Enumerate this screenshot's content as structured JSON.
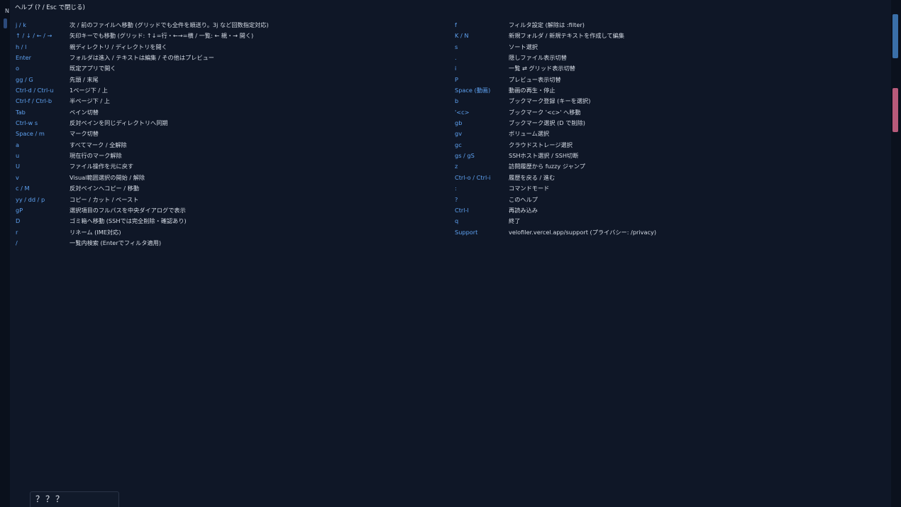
{
  "window": {
    "pane_letter": "N",
    "help_title": "ヘルプ (? / Esc で閉じる)"
  },
  "help": {
    "left": [
      {
        "key": "j / k",
        "desc": "次 / 前のファイルへ移動 (グリッドでも全件を順送り。3j など回数指定対応)"
      },
      {
        "key": "↑ / ↓ / ← / →",
        "desc": "矢印キーでも移動 (グリッド: ↑↓=行・←→=横 / 一覧: ← 親・→ 開く)"
      },
      {
        "key": "h / l",
        "desc": "親ディレクトリ / ディレクトリを開く"
      },
      {
        "key": "Enter",
        "desc": "フォルダは進入 / テキストは編集 / その他はプレビュー"
      },
      {
        "key": "o",
        "desc": "既定アプリで開く"
      },
      {
        "key": "gg / G",
        "desc": "先頭 / 末尾"
      },
      {
        "key": "Ctrl-d / Ctrl-u",
        "desc": "1ページ下 / 上"
      },
      {
        "key": "Ctrl-f / Ctrl-b",
        "desc": "半ページ下 / 上"
      },
      {
        "key": "Tab",
        "desc": "ペイン切替"
      },
      {
        "key": "Ctrl-w s",
        "desc": "反対ペインを同じディレクトリへ同期"
      },
      {
        "key": "Space / m",
        "desc": "マーク切替"
      },
      {
        "key": "a",
        "desc": "すべてマーク / 全解除"
      },
      {
        "key": "u",
        "desc": "現在行のマーク解除"
      },
      {
        "key": "U",
        "desc": "ファイル操作を元に戻す"
      },
      {
        "key": "v",
        "desc": "Visual範囲選択の開始 / 解除"
      },
      {
        "key": "c / M",
        "desc": "反対ペインへコピー / 移動"
      },
      {
        "key": "yy / dd / p",
        "desc": "コピー / カット / ペースト"
      },
      {
        "key": "gP",
        "desc": "選択項目のフルパスを中央ダイアログで表示"
      },
      {
        "key": "D",
        "desc": "ゴミ箱へ移動 (SSHでは完全削除・確認あり)"
      },
      {
        "key": "r",
        "desc": "リネーム (IME対応)"
      },
      {
        "key": "/",
        "desc": "一覧内検索 (Enterでフィルタ適用)"
      }
    ],
    "right": [
      {
        "key": "f",
        "desc": "フィルタ設定 (解除は :filter)"
      },
      {
        "key": "K / N",
        "desc": "新規フォルダ / 新規テキストを作成して編集"
      },
      {
        "key": "s",
        "desc": "ソート選択"
      },
      {
        "key": ".",
        "desc": "隠しファイル表示切替"
      },
      {
        "key": "i",
        "desc": "一覧 ⇄ グリッド表示切替"
      },
      {
        "key": "P",
        "desc": "プレビュー表示切替"
      },
      {
        "key": "Space (動画)",
        "desc": "動画の再生・停止"
      },
      {
        "key": "b",
        "desc": "ブックマーク登録 (キーを選択)"
      },
      {
        "key": "'<c>",
        "desc": "ブックマーク '<c>' へ移動"
      },
      {
        "key": "gb",
        "desc": "ブックマーク選択 (D で削除)"
      },
      {
        "key": "gv",
        "desc": "ボリューム選択"
      },
      {
        "key": "gc",
        "desc": "クラウドストレージ選択"
      },
      {
        "key": "gs / gS",
        "desc": "SSHホスト選択 / SSH切断"
      },
      {
        "key": "z",
        "desc": "訪問履歴から fuzzy ジャンプ"
      },
      {
        "key": "Ctrl-o / Ctrl-i",
        "desc": "履歴を戻る / 進む"
      },
      {
        "key": ":",
        "desc": "コマンドモード"
      },
      {
        "key": "?",
        "desc": "このヘルプ"
      },
      {
        "key": "Ctrl-l",
        "desc": "再読み込み"
      },
      {
        "key": "q",
        "desc": "終了"
      },
      {
        "key": "Support",
        "desc": "velofiler.vercel.app/support (プライバシー: /privacy)"
      }
    ]
  },
  "status": {
    "ime_text": "？？？"
  },
  "colors": {
    "key": "#5ea1f0",
    "text": "#d6dce6",
    "panel_bg": "#0f1727",
    "scroll_blue": "#3a6fa8",
    "scroll_pink": "#b75a7a"
  }
}
